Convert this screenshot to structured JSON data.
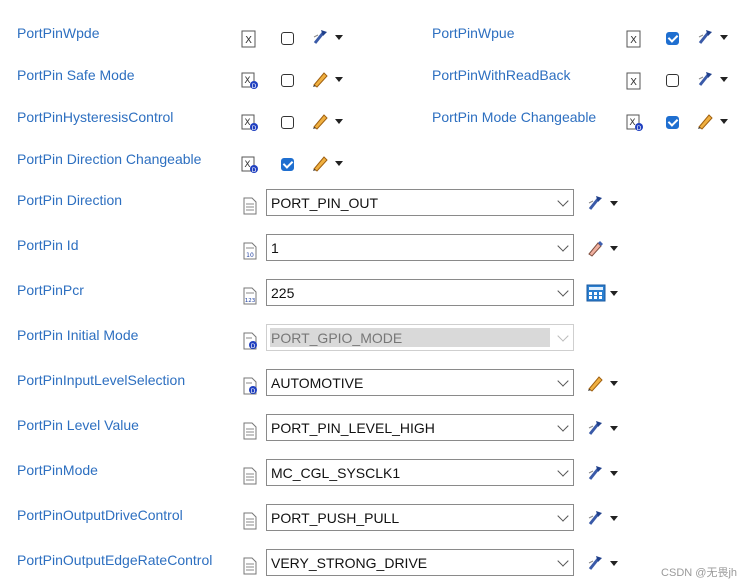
{
  "rows_top": [
    {
      "label": "PortPinWpde",
      "icon": "x-icon",
      "checked": false,
      "tool": "wand-icon"
    },
    {
      "label": "PortPin Safe Mode",
      "icon": "xd-icon",
      "checked": false,
      "tool": "pencil-icon"
    },
    {
      "label": "PortPinHysteresisControl",
      "icon": "xd-icon",
      "checked": false,
      "tool": "pencil-icon"
    },
    {
      "label": "PortPin Direction Changeable",
      "icon": "xd-icon",
      "checked": true,
      "tool": "pencil-icon"
    }
  ],
  "rows_right": [
    {
      "label": "PortPinWpue",
      "icon": "x-icon",
      "checked": true,
      "tool": "wand-icon"
    },
    {
      "label": "PortPinWithReadBack",
      "icon": "x-icon",
      "checked": false,
      "tool": "wand-icon"
    },
    {
      "label": "PortPin Mode Changeable",
      "icon": "xd-icon",
      "checked": true,
      "tool": "pencil-icon"
    }
  ],
  "combos": [
    {
      "label": "PortPin Direction",
      "value": "PORT_PIN_OUT",
      "icon": "doc-icon",
      "tool": "wand-icon",
      "disabled": false
    },
    {
      "label": "PortPin Id",
      "value": "1",
      "icon": "doc-num-icon",
      "tool": "highlighter-icon",
      "disabled": false
    },
    {
      "label": "PortPinPcr",
      "value": "225",
      "icon": "doc-123-icon",
      "tool": "calculator-icon",
      "disabled": false
    },
    {
      "label": "PortPin Initial Mode",
      "value": "PORT_GPIO_MODE",
      "icon": "doc-d-icon",
      "tool": "",
      "disabled": true
    },
    {
      "label": "PortPinInputLevelSelection",
      "value": "AUTOMOTIVE",
      "icon": "doc-d-icon",
      "tool": "pencil-icon",
      "disabled": false
    },
    {
      "label": "PortPin Level Value",
      "value": "PORT_PIN_LEVEL_HIGH",
      "icon": "doc-icon",
      "tool": "wand-icon",
      "disabled": false
    },
    {
      "label": "PortPinMode",
      "value": "MC_CGL_SYSCLK1",
      "icon": "doc-icon",
      "tool": "wand-icon",
      "disabled": false
    },
    {
      "label": "PortPinOutputDriveControl",
      "value": "PORT_PUSH_PULL",
      "icon": "doc-icon",
      "tool": "wand-icon",
      "disabled": false
    },
    {
      "label": "PortPinOutputEdgeRateControl",
      "value": "VERY_STRONG_DRIVE",
      "icon": "doc-icon",
      "tool": "wand-icon",
      "disabled": false
    }
  ],
  "watermark": "CSDN @无畏jh",
  "colors": {
    "label": "#2d6fc0",
    "checkbox_on": "#1f6fd0",
    "wand": "#3a5aa8",
    "pencil": "#d08a1a"
  }
}
